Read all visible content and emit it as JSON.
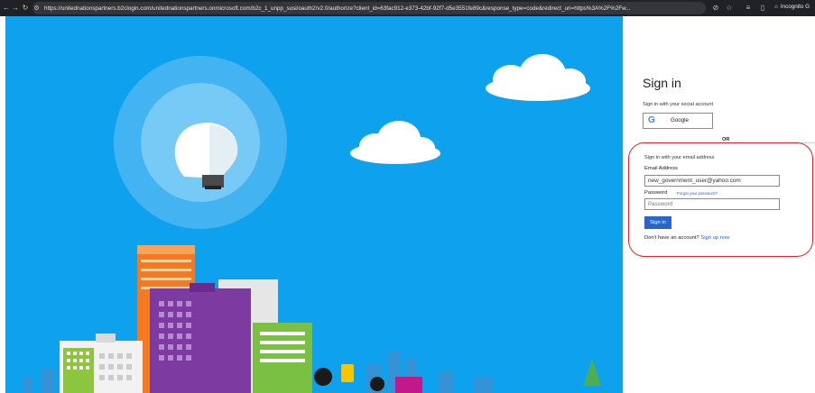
{
  "browser": {
    "url": "https://unitednationspartners.b2clogin.com/unitednationspartners.onmicrosoft.com/b2c_1_unpp_susi/oauth2/v2.0/authorize?client_id=63fac912-e373-42bf-92f7-d5e3551fe89c&response_type=code&redirect_uri=https%3A%2F%2Fw...",
    "mode_label": "Incognito G"
  },
  "signin": {
    "title": "Sign in",
    "social_label": "Sign in with your social account",
    "google_label": "Google",
    "or_text": "OR",
    "email_section_label": "Sign in with your email address",
    "email_label": "Email Address",
    "email_value": "new_government_user@yahoo.com",
    "password_label": "Password",
    "forgot_password": "Forgot your password?",
    "password_placeholder": "Password",
    "signin_button": "Sign in",
    "no_account_text": "Don't have an account?",
    "signup_link": "Sign up now"
  },
  "colors": {
    "hero_blue": "#0ea2ee",
    "link_blue": "#2a65c9",
    "annotation_red": "#e0262b"
  }
}
